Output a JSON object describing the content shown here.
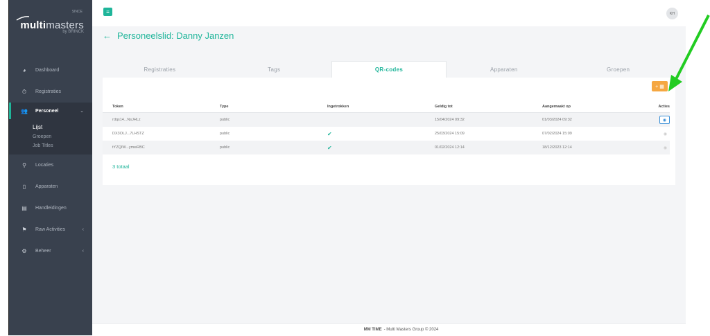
{
  "logo": {
    "brand": "multi",
    "brand_thin": "masters",
    "tagline": "by BRINCK",
    "small": "SINCE"
  },
  "sidebar": {
    "items": [
      {
        "label": "Dashboard",
        "icon": "dashboard-icon"
      },
      {
        "label": "Registraties",
        "icon": "stopwatch-icon"
      },
      {
        "label": "Personeel",
        "icon": "users-icon"
      },
      {
        "label": "Locaties",
        "icon": "map-pin-icon"
      },
      {
        "label": "Apparaten",
        "icon": "mobile-icon"
      },
      {
        "label": "Handleidingen",
        "icon": "book-icon"
      },
      {
        "label": "Raw Activities",
        "icon": "flag-icon"
      },
      {
        "label": "Beheer",
        "icon": "gear-icon"
      }
    ],
    "subitems": [
      "Lijst",
      "Groepen",
      "Job Titles"
    ]
  },
  "header": {
    "avatar": "KH"
  },
  "page": {
    "title": "Personeelslid: Danny Janzen"
  },
  "tabs": [
    "Registraties",
    "Tags",
    "QR-codes",
    "Apparaten",
    "Groepen"
  ],
  "card": {
    "add_label": "+ ▦"
  },
  "table": {
    "columns": [
      "Token",
      "Type",
      "Ingetrokken",
      "Geldig tot",
      "Aangemaakt op",
      "Acties"
    ],
    "rows": [
      {
        "token": "rdqs14...NsJHLz",
        "type": "public",
        "revoked": "",
        "valid_until": "15/04/2024 09:32",
        "created": "01/03/2024 09:32"
      },
      {
        "token": "DX3OLJ...7LHSTZ",
        "type": "public",
        "revoked": "✔",
        "valid_until": "25/03/2024 15:09",
        "created": "07/02/2024 15:09"
      },
      {
        "token": "tYZQIW...ymwRBC",
        "type": "public",
        "revoked": "✔",
        "valid_until": "01/02/2024 12:14",
        "created": "18/12/2023 12:14"
      }
    ],
    "total": "3 totaal"
  },
  "footer": {
    "brand": "MM TIME",
    "text": "- Multi Masters Group © 2024"
  },
  "colors": {
    "accent": "#1fb59a",
    "sidebar": "#39414e",
    "orange": "#f5a742",
    "arrow": "#22cc22"
  }
}
